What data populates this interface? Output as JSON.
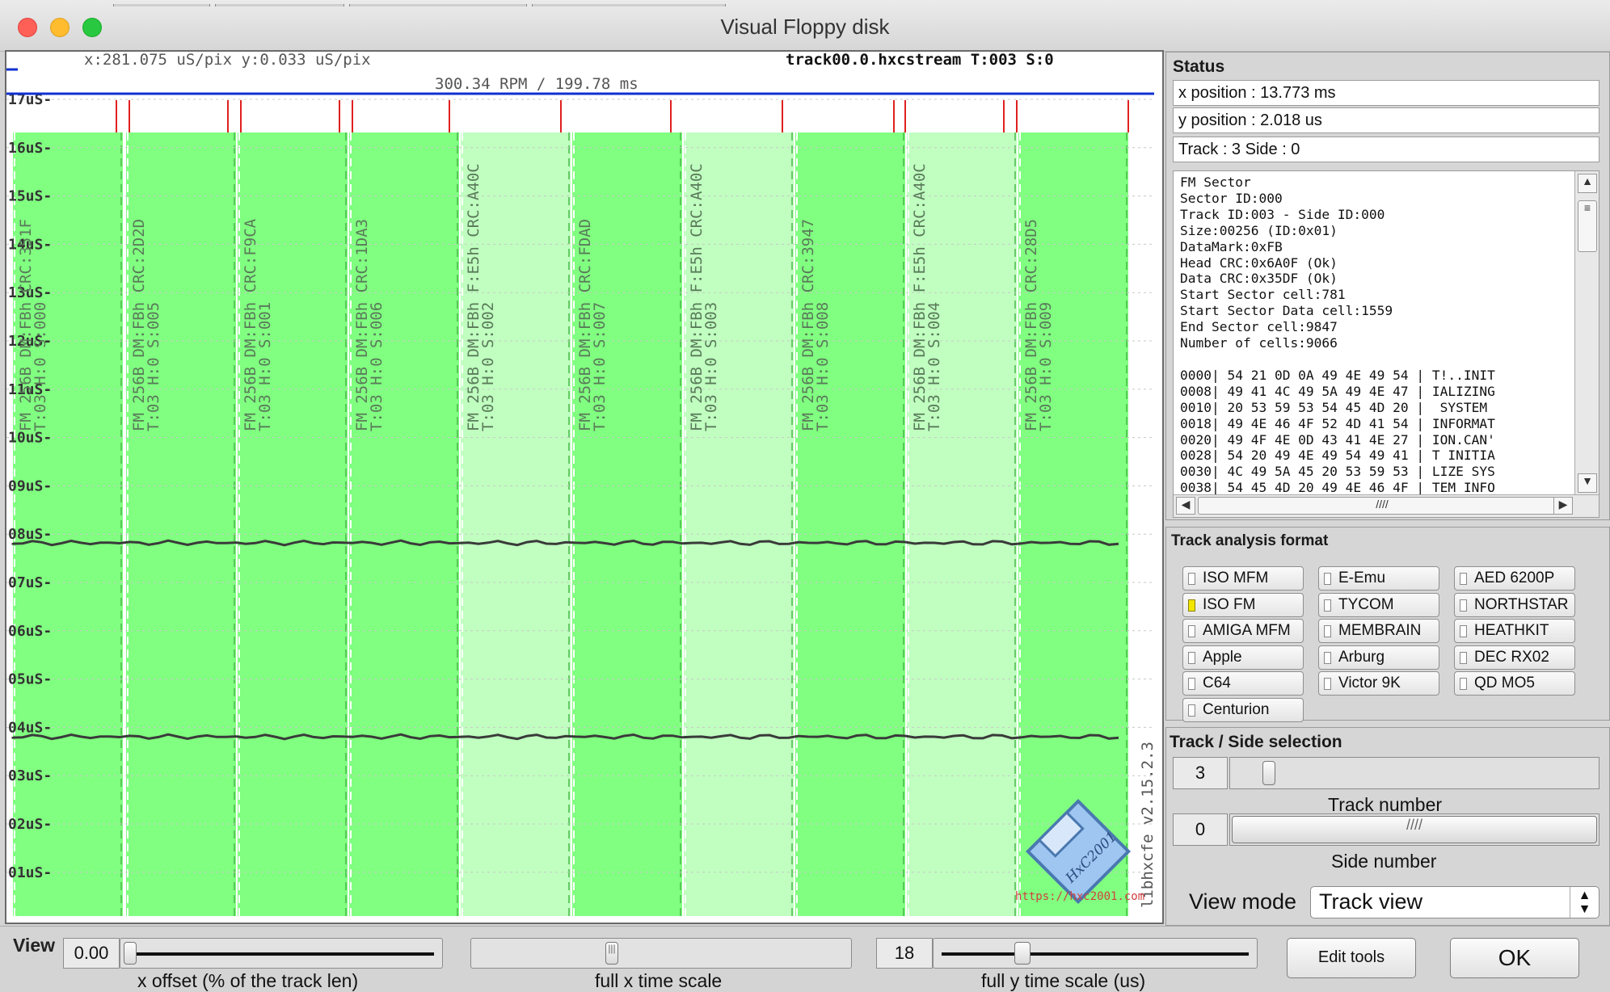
{
  "window": {
    "title": "Visual Floppy disk"
  },
  "plot": {
    "header_left": "x:281.075 uS/pix y:0.033 uS/pix",
    "header_right": "track00.0.hxcstream T:003 S:0",
    "rpm_line": "300.34 RPM / 199.78 ms",
    "y_ticks": [
      "17uS-",
      "16uS-",
      "15uS-",
      "14uS-",
      "13uS-",
      "12uS-",
      "11uS-",
      "10uS-",
      "09uS-",
      "08uS-",
      "07uS-",
      "06uS-",
      "05uS-",
      "04uS-",
      "03uS-",
      "02uS-",
      "01uS-"
    ],
    "sectors": [
      {
        "line1": "FM 256B DM:FBh CRC:351F",
        "line2": "T:03 H:0 S:000"
      },
      {
        "line1": "FM 256B DM:FBh CRC:2D2D",
        "line2": "T:03 H:0 S:005"
      },
      {
        "line1": "FM 256B DM:FBh CRC:F9CA",
        "line2": "T:03 H:0 S:001"
      },
      {
        "line1": "FM 256B DM:FBh CRC:1DA3",
        "line2": "T:03 H:0 S:006"
      },
      {
        "line1": "FM 256B DM:FBh F:E5h CRC:A40C",
        "line2": "T:03 H:0 S:002"
      },
      {
        "line1": "FM 256B DM:FBh CRC:FDAD",
        "line2": "T:03 H:0 S:007"
      },
      {
        "line1": "FM 256B DM:FBh F:E5h CRC:A40C",
        "line2": "T:03 H:0 S:003"
      },
      {
        "line1": "FM 256B DM:FBh CRC:3947",
        "line2": "T:03 H:0 S:008"
      },
      {
        "line1": "FM 256B DM:FBh F:E5h CRC:A40C",
        "line2": "T:03 H:0 S:004"
      },
      {
        "line1": "FM 256B DM:FBh CRC:28D5",
        "line2": "T:03 H:0 S:009"
      }
    ],
    "version_text": "libhxcfe v2.15.2.3",
    "logo_text": "HxC2001",
    "url_text": "https://hxc2001.com",
    "colors": {
      "sector_bright": "#80ff80",
      "sector_pale": "#c0ffc0",
      "index_line": "#1030d0",
      "pulse": "#e02020"
    }
  },
  "status": {
    "title": "Status",
    "x_position": "x position : 13.773 ms",
    "y_position": "y position : 2.018 us",
    "track_side": "Track : 3 Side : 0",
    "info_lines": [
      "FM Sector",
      "Sector ID:000",
      "Track ID:003 - Side ID:000",
      "Size:00256 (ID:0x01)",
      "DataMark:0xFB",
      "Head CRC:0x6A0F (Ok)",
      "Data CRC:0x35DF (Ok)",
      "Start Sector cell:781",
      "Start Sector Data cell:1559",
      "End Sector cell:9847",
      "Number of cells:9066",
      "",
      "0000| 54 21 0D 0A 49 4E 49 54 | T!..INIT",
      "0008| 49 41 4C 49 5A 49 4E 47 | IALIZING",
      "0010| 20 53 59 53 54 45 4D 20 |  SYSTEM ",
      "0018| 49 4E 46 4F 52 4D 41 54 | INFORMAT",
      "0020| 49 4F 4E 0D 43 41 4E 27 | ION.CAN'",
      "0028| 54 20 49 4E 49 54 49 41 | T INITIA",
      "0030| 4C 49 5A 45 20 53 59 53 | LIZE SYS",
      "0038| 54 45 4D 20 49 4E 46 4F | TEM INFO"
    ]
  },
  "analysis": {
    "title": "Track analysis format",
    "formats": [
      [
        "ISO MFM",
        "E-Emu",
        "AED 6200P"
      ],
      [
        "ISO FM",
        "TYCOM",
        "NORTHSTAR"
      ],
      [
        "AMIGA MFM",
        "MEMBRAIN",
        "HEATHKIT"
      ],
      [
        "Apple",
        "Arburg",
        "DEC RX02"
      ],
      [
        "C64",
        "Victor 9K",
        "QD MO5"
      ],
      [
        "Centurion"
      ]
    ],
    "selected": "ISO FM"
  },
  "track_side": {
    "title": "Track / Side selection",
    "track_value": "3",
    "track_label": "Track number",
    "side_value": "0",
    "side_label": "Side number",
    "view_mode_label": "View mode",
    "view_mode_value": "Track view"
  },
  "bottom": {
    "view_label": "View",
    "x_offset_value": "0.00",
    "x_offset_label": "x offset (% of the track len)",
    "x_scale_label": "full x time scale",
    "y_scale_value": "18",
    "y_scale_label": "full y time scale (us)",
    "edit_tools": "Edit tools",
    "ok": "OK"
  }
}
